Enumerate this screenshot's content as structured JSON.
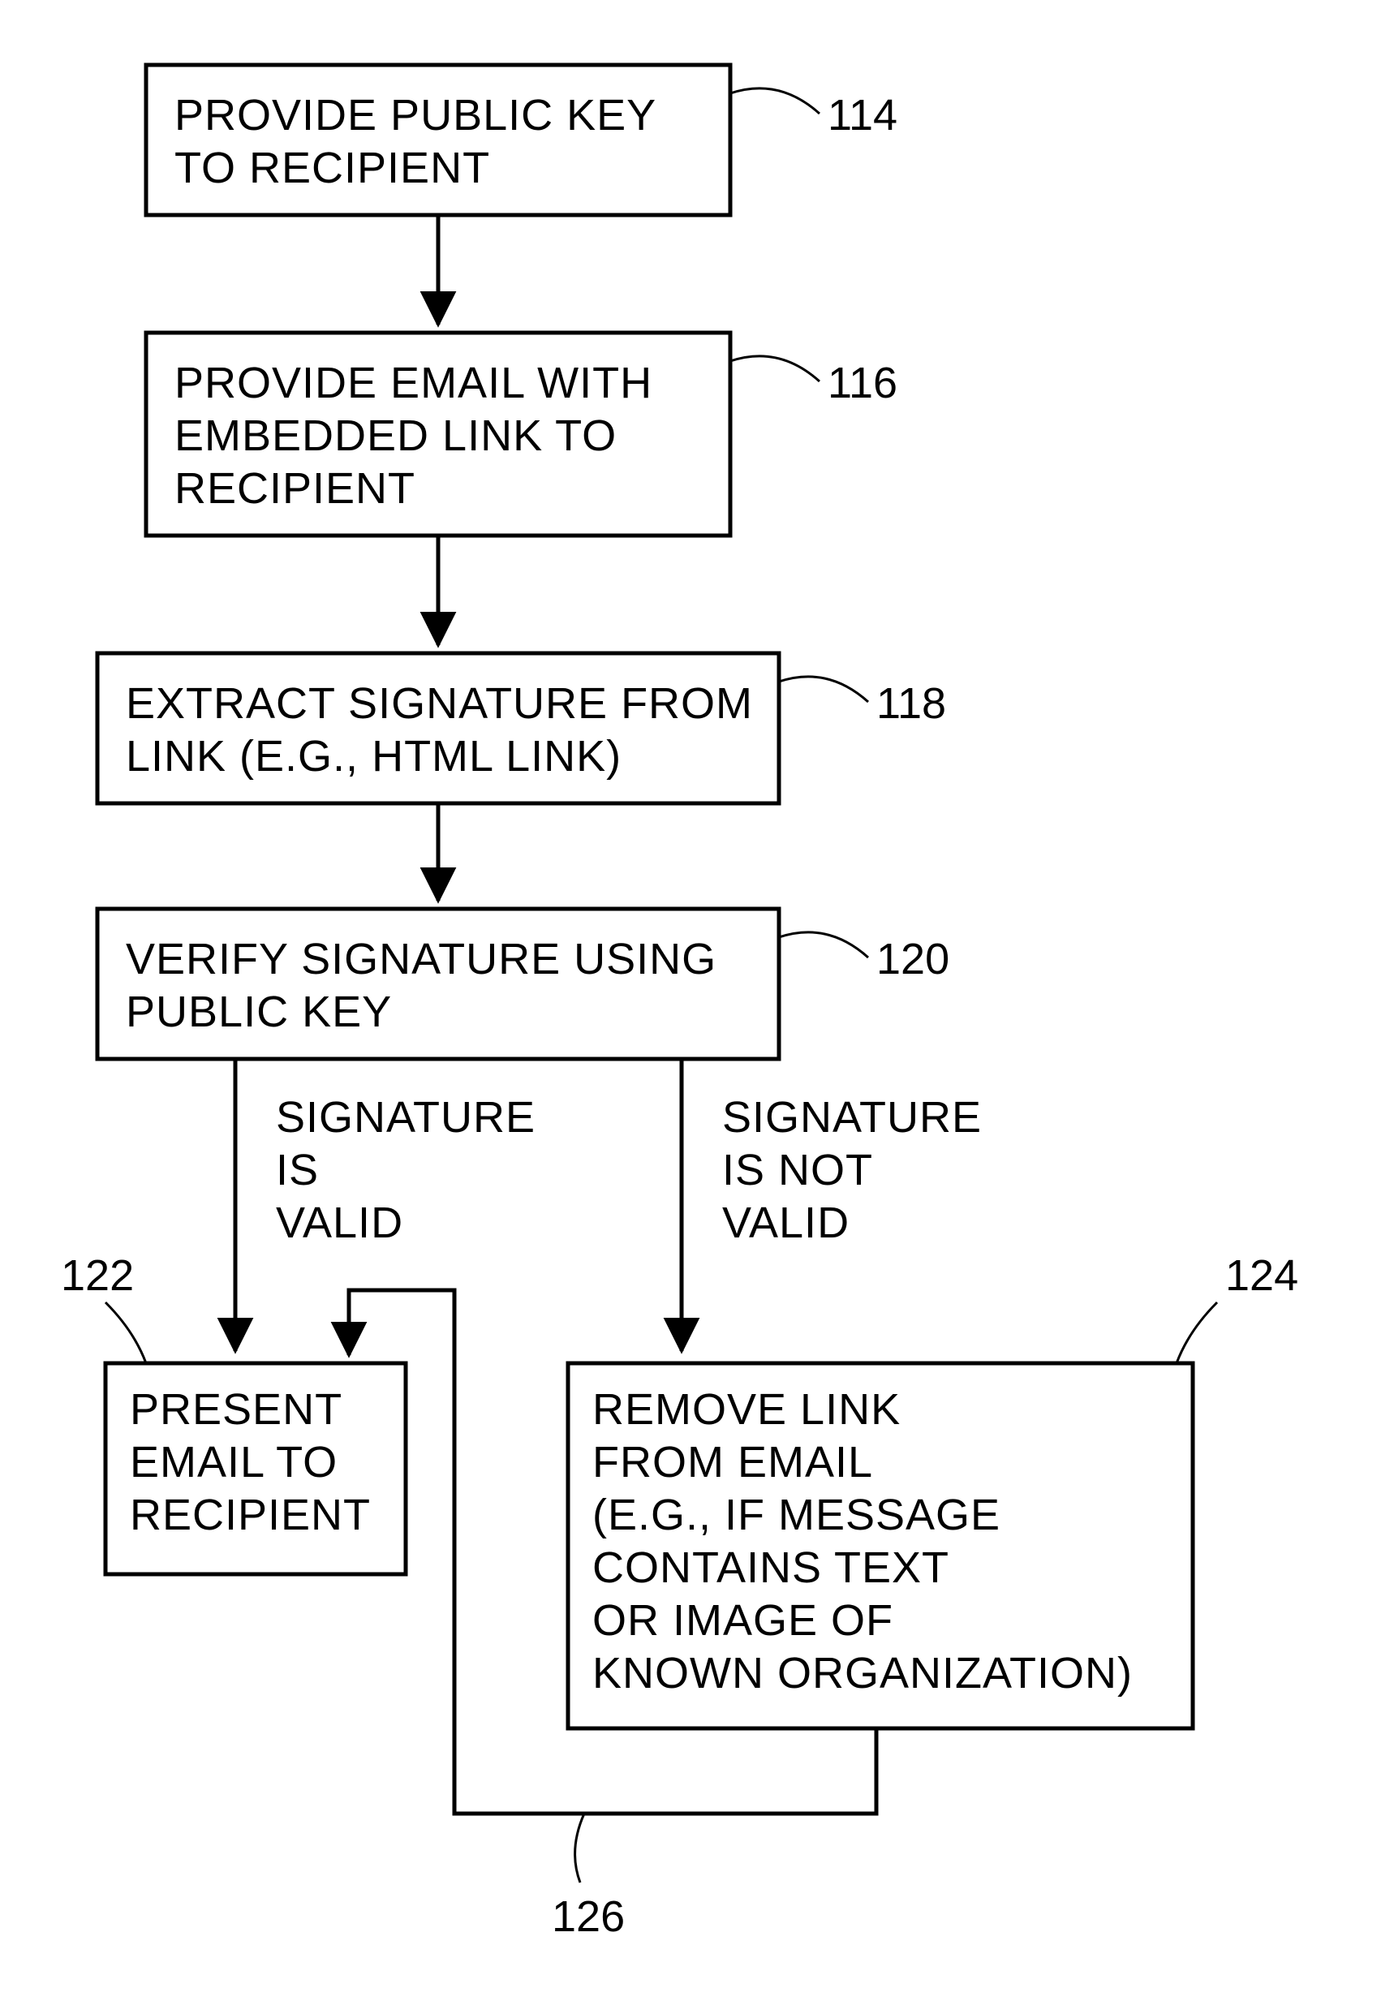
{
  "boxes": {
    "b114": {
      "ref": "114",
      "lines": [
        "PROVIDE PUBLIC KEY",
        "TO RECIPIENT"
      ]
    },
    "b116": {
      "ref": "116",
      "lines": [
        "PROVIDE EMAIL WITH",
        "EMBEDDED LINK TO",
        "RECIPIENT"
      ]
    },
    "b118": {
      "ref": "118",
      "lines": [
        "EXTRACT SIGNATURE FROM",
        "LINK (E.G., HTML LINK)"
      ]
    },
    "b120": {
      "ref": "120",
      "lines": [
        "VERIFY SIGNATURE USING",
        "PUBLIC KEY"
      ]
    },
    "b122": {
      "ref": "122",
      "lines": [
        "PRESENT",
        "EMAIL TO",
        "RECIPIENT"
      ]
    },
    "b124": {
      "ref": "124",
      "lines": [
        "REMOVE LINK",
        "FROM EMAIL",
        "(E.G., IF MESSAGE",
        "CONTAINS TEXT",
        "OR IMAGE OF",
        "KNOWN ORGANIZATION)"
      ]
    }
  },
  "edges": {
    "valid": {
      "lines": [
        "SIGNATURE",
        "IS",
        "VALID"
      ]
    },
    "invalid": {
      "lines": [
        "SIGNATURE",
        "IS NOT",
        "VALID"
      ]
    }
  },
  "loopRef": "126"
}
